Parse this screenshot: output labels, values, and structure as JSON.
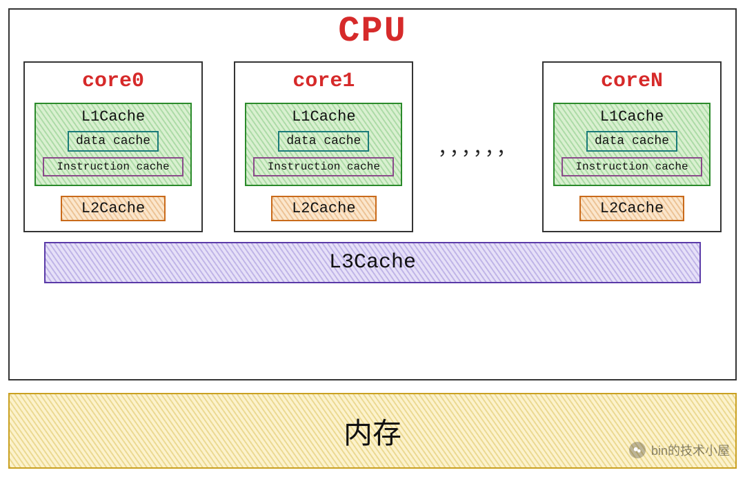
{
  "colors": {
    "accent": "#d62a2a"
  },
  "cpu": {
    "title": "CPU",
    "l3_label": "L3Cache",
    "cores": [
      {
        "name": "core0",
        "l1_label": "L1Cache",
        "data_cache": "data cache",
        "instruction_cache": "Instruction cache",
        "l2_label": "L2Cache"
      },
      {
        "name": "core1",
        "l1_label": "L1Cache",
        "data_cache": "data cache",
        "instruction_cache": "Instruction cache",
        "l2_label": "L2Cache"
      },
      {
        "name": "coreN",
        "l1_label": "L1Cache",
        "data_cache": "data cache",
        "instruction_cache": "Instruction cache",
        "l2_label": "L2Cache"
      }
    ],
    "ellipsis": "，，，，，，"
  },
  "memory": {
    "label": "内存"
  },
  "watermark": {
    "text": "bin的技术小屋",
    "icon": "wechat-icon"
  }
}
